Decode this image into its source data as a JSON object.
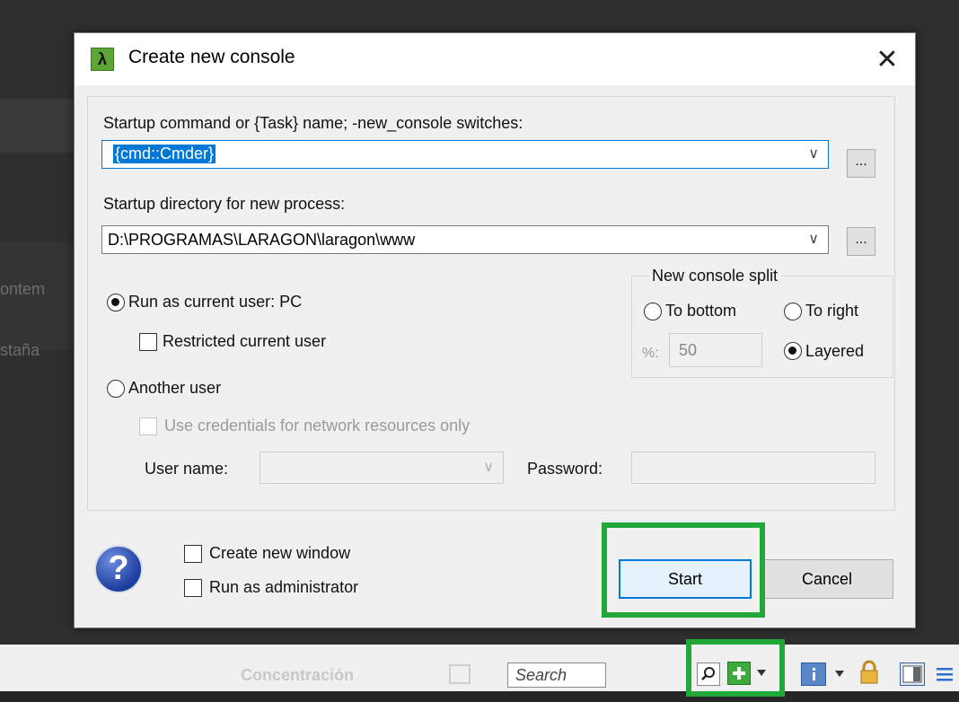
{
  "background": {
    "fragment_a": "ontem",
    "fragment_b": "staña",
    "ghost_toolbar_label": "Concentración"
  },
  "dialog": {
    "title": "Create new console",
    "app_icon_glyph": "λ",
    "close_glyph": "✕",
    "startup_command_label": "Startup command or {Task} name; -new_console switches:",
    "startup_command_value": "{cmd::Cmder}",
    "startup_dir_label": "Startup directory for new process:",
    "startup_dir_value": "D:\\PROGRAMAS\\LARAGON\\laragon\\www",
    "browse_label": "...",
    "dropdown_glyph": "∨",
    "split": {
      "group_title": "New console split",
      "to_bottom": "To bottom",
      "to_right": "To right",
      "percent_label": "%:",
      "percent_value": "50",
      "layered": "Layered",
      "selected": "Layered"
    },
    "run_as_current": "Run as current user: PC",
    "restricted_user": "Restricted current user",
    "another_user": "Another user",
    "use_credentials": "Use credentials for network resources only",
    "user_name_label": "User name:",
    "password_label": "Password:",
    "create_new_window": "Create new window",
    "run_as_admin": "Run as administrator",
    "help_glyph": "?",
    "start_label": "Start",
    "cancel_label": "Cancel"
  },
  "toolbar": {
    "search_placeholder": "Search",
    "search_icon": "magnifier-icon",
    "new_console_icon": "plus-icon",
    "lock_icon": "lock-icon"
  },
  "colors": {
    "highlight": "#22a83a",
    "accent": "#0078d7"
  }
}
